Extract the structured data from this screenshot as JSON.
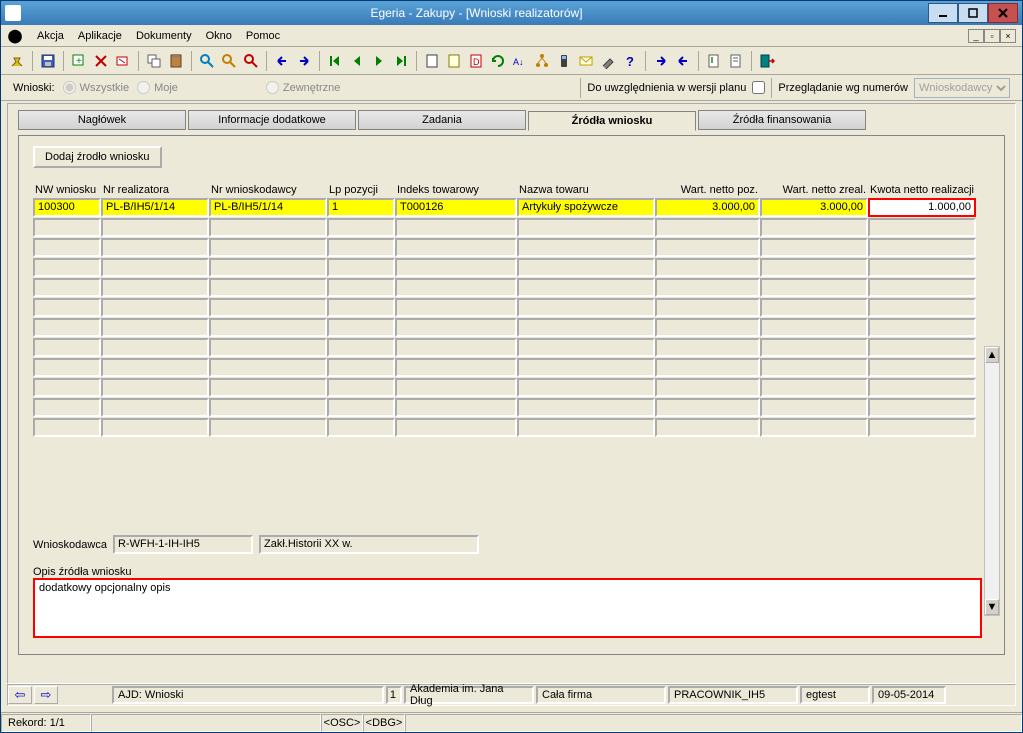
{
  "window": {
    "title": "Egeria - Zakupy - [Wnioski realizatorów]"
  },
  "menu": {
    "akcja": "Akcja",
    "aplikacje": "Aplikacje",
    "dokumenty": "Dokumenty",
    "okno": "Okno",
    "pomoc": "Pomoc"
  },
  "filter": {
    "label": "Wnioski:",
    "wszystkie": "Wszystkie",
    "moje": "Moje",
    "zewnetrzne": "Zewnętrzne",
    "uwzgl": "Do uwzględnienia w wersji planu",
    "przegl": "Przeglądanie wg numerów",
    "sel": "Wnioskodawcy"
  },
  "tabs": {
    "naglowek": "Nagłówek",
    "info": "Informacje dodatkowe",
    "zadania": "Zadania",
    "zrodla": "Źródła wniosku",
    "finans": "Źródła finansowania"
  },
  "btn_dodaj": "Dodaj źrodło wniosku",
  "gh": {
    "c0": "NW wniosku",
    "c1": "Nr realizatora",
    "c2": "Nr wnioskodawcy",
    "c3": "Lp pozycji",
    "c4": "Indeks towarowy",
    "c5": "Nazwa towaru",
    "c6": "Wart. netto poz.",
    "c7": "Wart. netto zreal.",
    "c8": "Kwota netto realizacji"
  },
  "row": {
    "c0": "100300",
    "c1": "PL-B/IH5/1/14",
    "c2": "PL-B/IH5/1/14",
    "c3": "1",
    "c4": "T000126",
    "c5": "Artykuły spożywcze",
    "c6": "3.000,00",
    "c7": "3.000,00",
    "c8": "1.000,00"
  },
  "wn": {
    "label": "Wnioskodawca",
    "code": "R-WFH-1-IH-IH5",
    "name": "Zakł.Historii XX w."
  },
  "opis": {
    "label": "Opis źródła wniosku",
    "text": "dodatkowy opcjonalny opis"
  },
  "bbar": {
    "b0": "AJD: Wnioski",
    "b1": "1",
    "b2": "Akademia im. Jana Dług",
    "b3": "Cała firma",
    "b4": "PRACOWNIK_IH5",
    "b5": "egtest",
    "b6": "09-05-2014"
  },
  "status": {
    "rekord": "Rekord: 1/1",
    "osc": "<OSC>",
    "dbg": "<DBG>"
  }
}
